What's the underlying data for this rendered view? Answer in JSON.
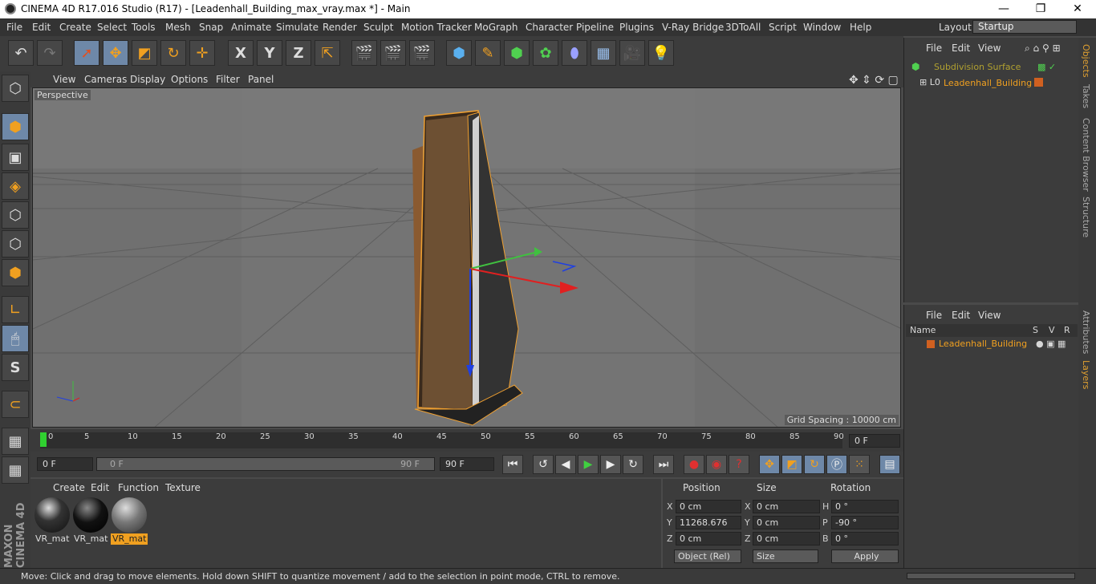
{
  "app": {
    "title": "CINEMA 4D R17.016 Studio (R17) - [Leadenhall_Building_max_vray.max *] - Main"
  },
  "window_controls": {
    "minimize": "—",
    "maximize": "❐",
    "close": "✕"
  },
  "menubar": {
    "items": [
      "File",
      "Edit",
      "Create",
      "Select",
      "Tools",
      "Mesh",
      "Snap",
      "Animate",
      "Simulate",
      "Render",
      "Sculpt",
      "Motion Tracker",
      "MoGraph",
      "Character",
      "Pipeline",
      "Plugins",
      "V-Ray Bridge",
      "3DToAll",
      "Script",
      "Window",
      "Help"
    ],
    "layout_label": "Layout:",
    "layout_value": "Startup"
  },
  "viewport": {
    "menu": [
      "View",
      "Cameras",
      "Display",
      "Options",
      "Filter",
      "Panel"
    ],
    "label": "Perspective",
    "grid_spacing": "Grid Spacing : 10000 cm"
  },
  "timeline": {
    "ticks": [
      "0",
      "5",
      "10",
      "15",
      "20",
      "25",
      "30",
      "35",
      "40",
      "45",
      "50",
      "55",
      "60",
      "65",
      "70",
      "75",
      "80",
      "85",
      "90"
    ],
    "current": "0 F"
  },
  "anim": {
    "start": "0 F",
    "slider_start": "0 F",
    "slider_end": "90 F",
    "end": "90 F"
  },
  "materials": {
    "menu": [
      "Create",
      "Edit",
      "Function",
      "Texture"
    ],
    "items": [
      "VR_mat",
      "VR_mat",
      "VR_mat"
    ]
  },
  "coords": {
    "headers": [
      "Position",
      "Size",
      "Rotation"
    ],
    "pos": {
      "x": "0 cm",
      "y": "11268.676 cm",
      "z": "0 cm"
    },
    "size": {
      "x": "0 cm",
      "y": "0 cm",
      "z": "0 cm"
    },
    "rot": {
      "h": "0 °",
      "p": "-90 °",
      "b": "0 °"
    },
    "mode": "Object (Rel)",
    "size_mode": "Size",
    "apply": "Apply"
  },
  "objects": {
    "menu": [
      "File",
      "Edit",
      "View"
    ],
    "items": [
      "Subdivision Surface",
      "Leadenhall_Building"
    ]
  },
  "layers": {
    "menu": [
      "File",
      "Edit",
      "View"
    ],
    "headers": [
      "Name",
      "S",
      "V",
      "R"
    ],
    "items": [
      "Leadenhall_Building"
    ]
  },
  "sidetabs": [
    "Objects",
    "Takes",
    "Content Browser",
    "Structure",
    "Attributes",
    "Layers"
  ],
  "status": "Move: Click and drag to move elements. Hold down SHIFT to quantize movement / add to the selection in point mode, CTRL to remove."
}
